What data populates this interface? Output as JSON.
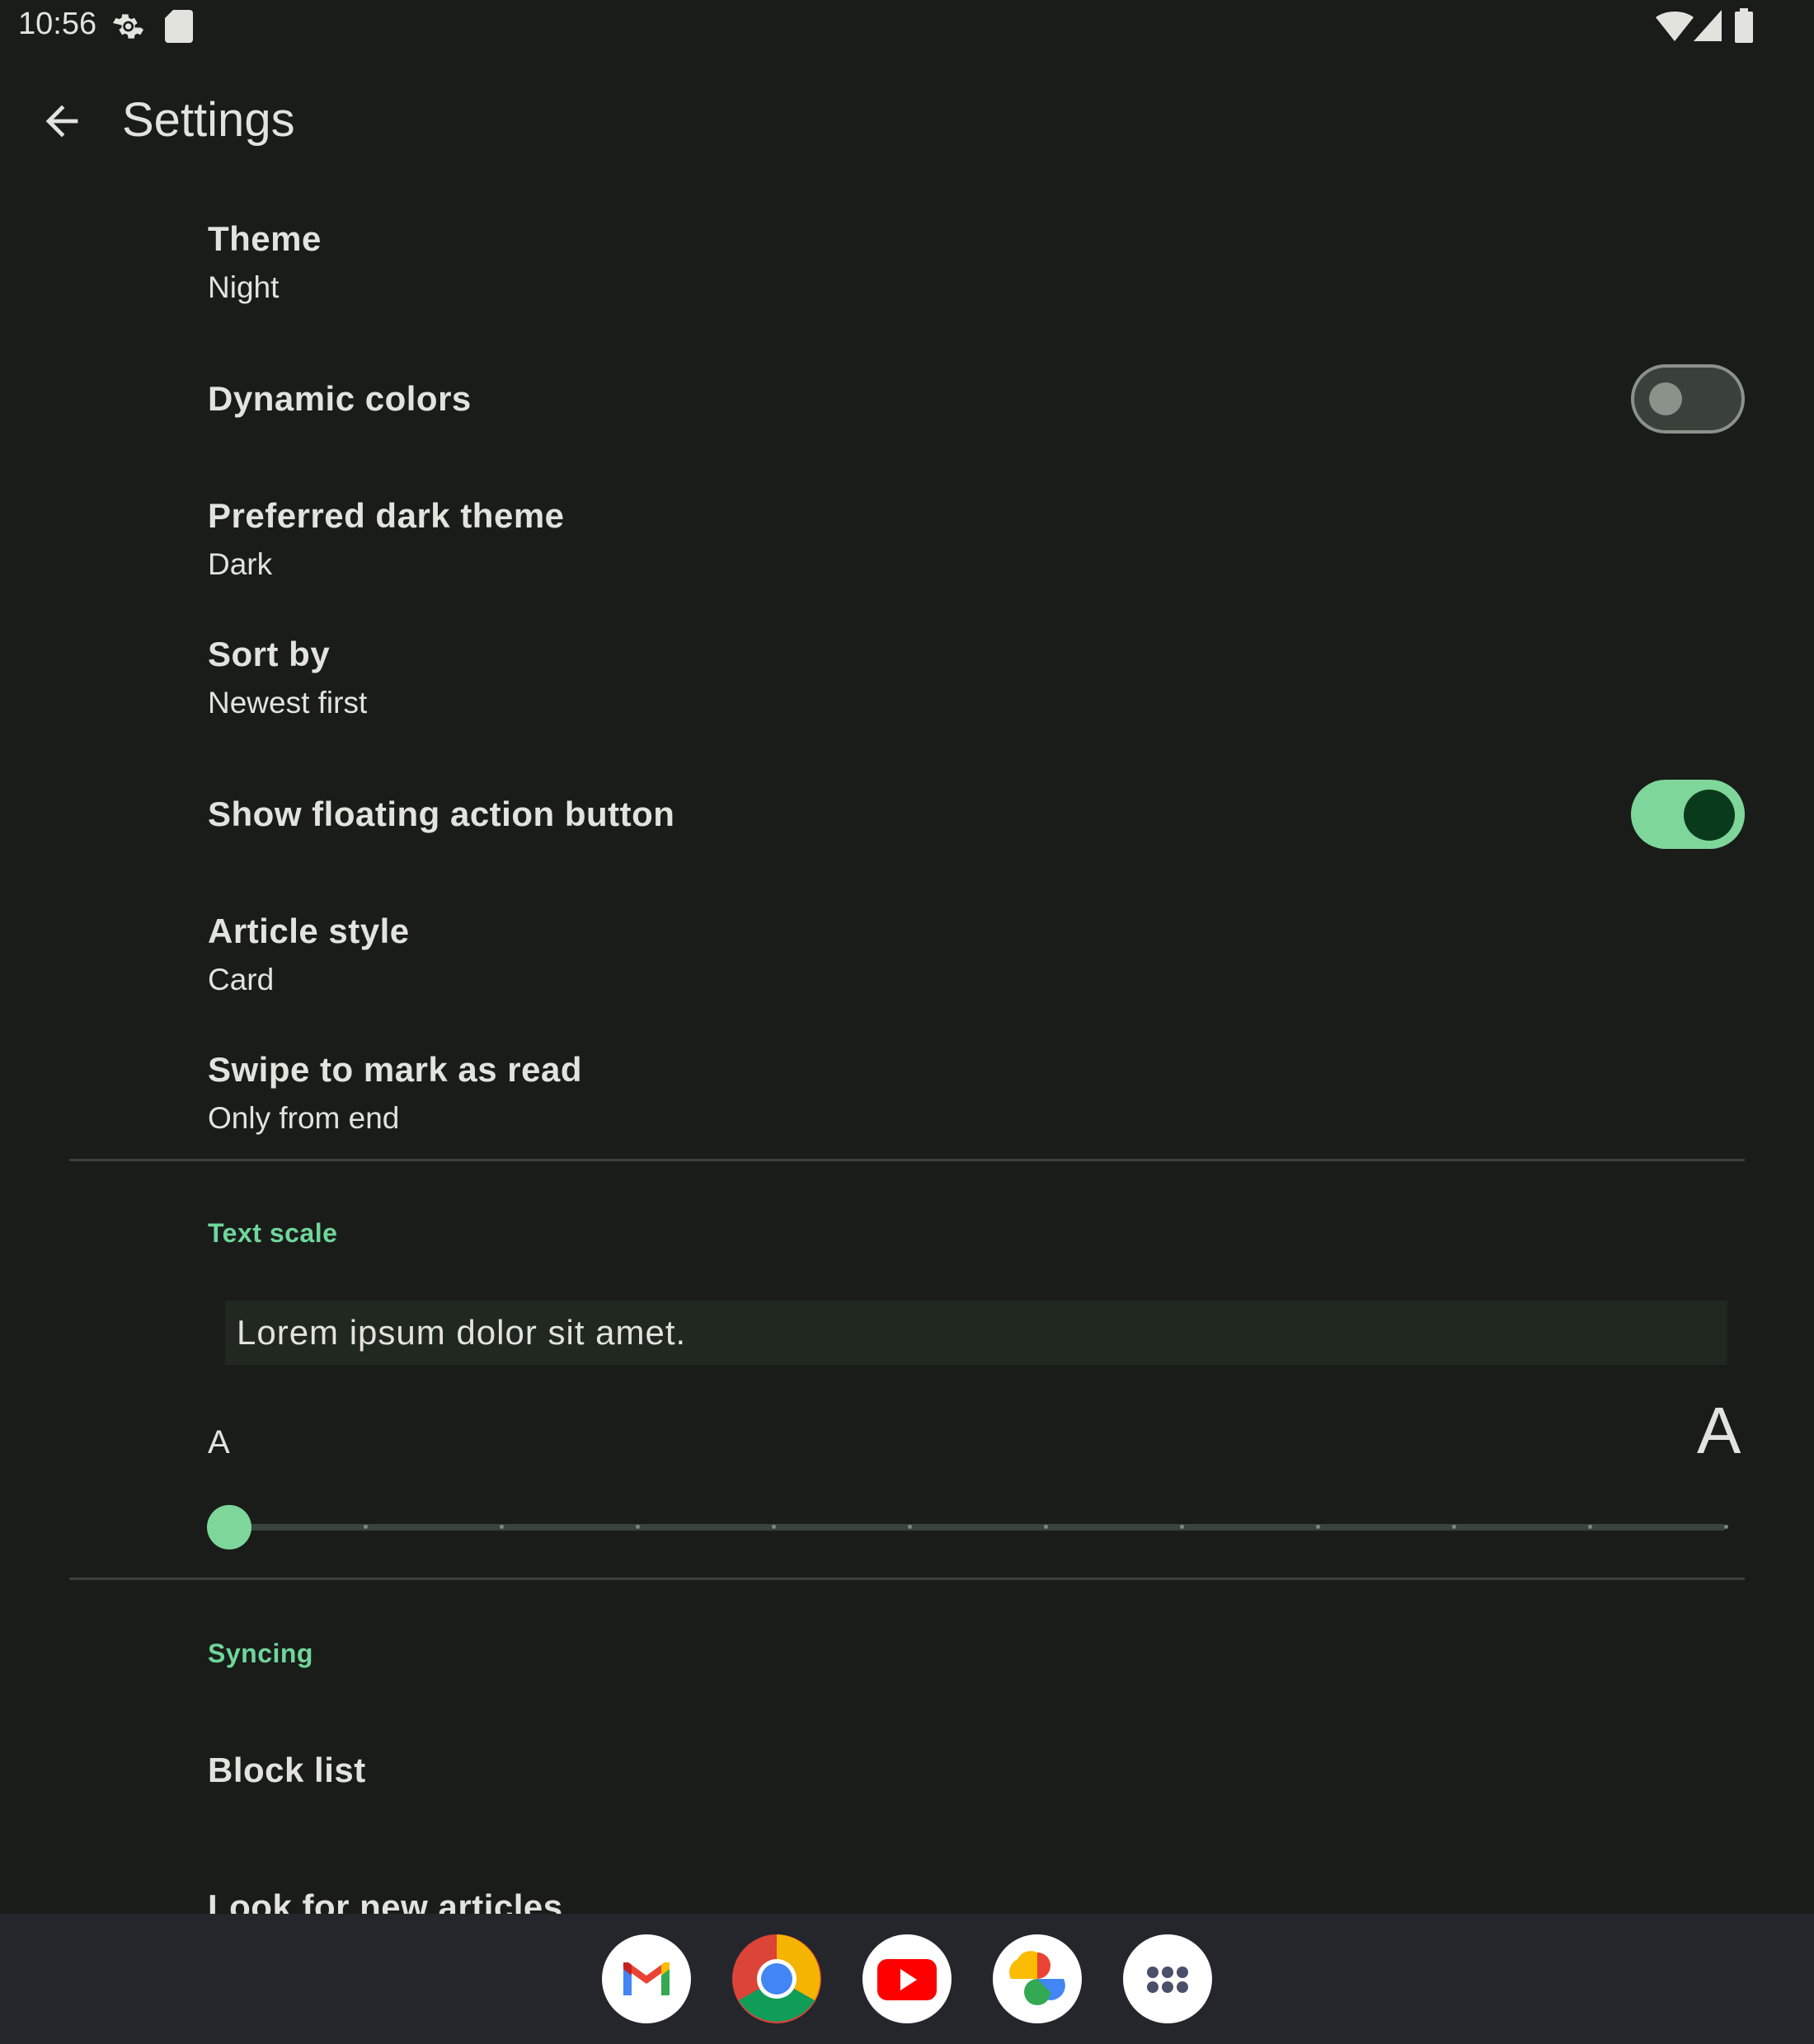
{
  "status_bar": {
    "time": "10:56",
    "icons": [
      "settings-icon",
      "sd-card-icon",
      "wifi-icon",
      "cell-signal-icon",
      "battery-icon"
    ]
  },
  "app_bar": {
    "title": "Settings",
    "back_icon": "arrow-back-icon"
  },
  "prefs": {
    "theme": {
      "title": "Theme",
      "value": "Night"
    },
    "dynamic_colors": {
      "title": "Dynamic colors",
      "enabled": false
    },
    "preferred_dark_theme": {
      "title": "Preferred dark theme",
      "value": "Dark"
    },
    "sort_by": {
      "title": "Sort by",
      "value": "Newest first"
    },
    "show_fab": {
      "title": "Show floating action button",
      "enabled": true
    },
    "article_style": {
      "title": "Article style",
      "value": "Card"
    },
    "swipe_to_mark": {
      "title": "Swipe to mark as read",
      "value": "Only from end"
    }
  },
  "text_scale": {
    "header": "Text scale",
    "preview": "Lorem ipsum dolor sit amet.",
    "small_label": "A",
    "large_label": "A",
    "slider_value": 0
  },
  "syncing": {
    "header": "Syncing",
    "block_list": "Block list",
    "look_for_new": "Look for new articles"
  },
  "dock": {
    "apps": [
      "gmail-icon",
      "chrome-icon",
      "youtube-icon",
      "photos-icon",
      "app-drawer-icon"
    ]
  },
  "colors": {
    "background": "#1a1c1a",
    "accent": "#7ed69a",
    "section_header": "#6fd69a",
    "dock": "#24262c"
  }
}
